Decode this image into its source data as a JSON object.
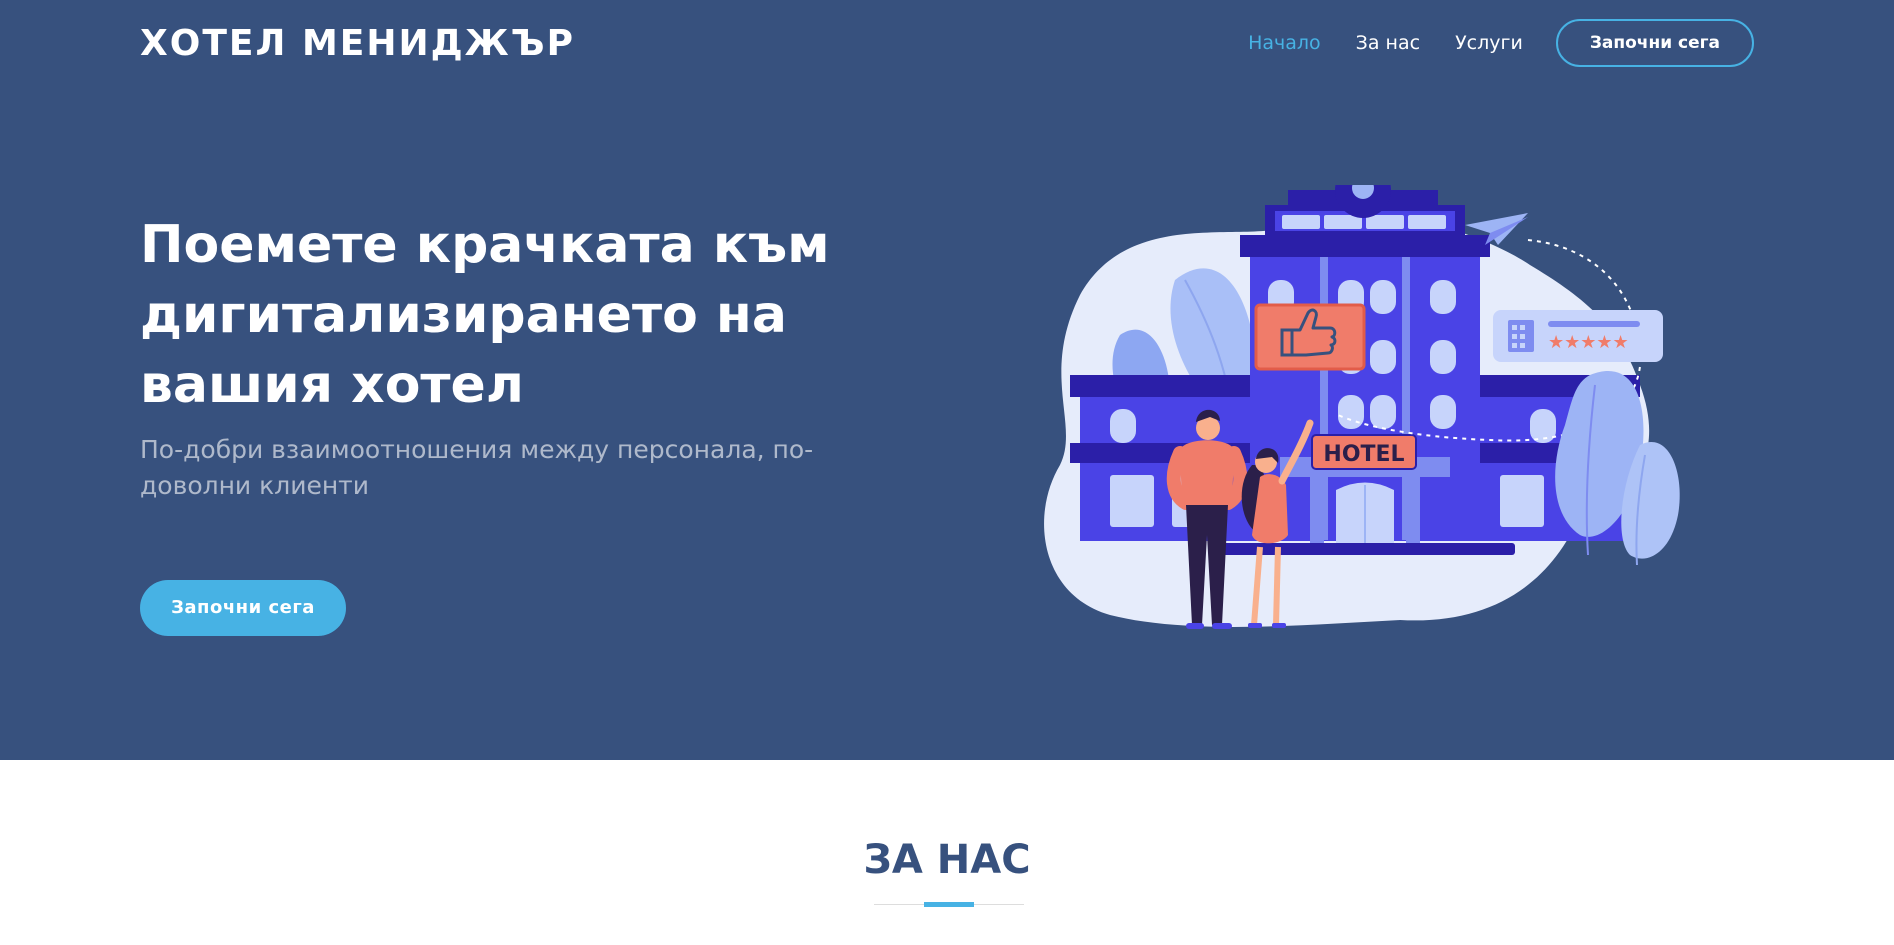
{
  "header": {
    "logo": "ХОТЕЛ МЕНИДЖЪР",
    "nav": [
      {
        "label": "Начало",
        "active": true
      },
      {
        "label": "За нас",
        "active": false
      },
      {
        "label": "Услуги",
        "active": false
      }
    ],
    "cta_label": "Започни сега"
  },
  "hero": {
    "title_lines": [
      "Поемете крачката към",
      "дигитализирането на",
      "вашия хотел"
    ],
    "subtitle": "По-добри взаимоотношения между персонала, по-доволни клиенти",
    "button_label": "Започни сега",
    "illustration": {
      "sign_text": "HOTEL",
      "rating_stars": 5,
      "icons": [
        "thumbs-up-icon",
        "paper-plane-icon",
        "building-icon",
        "star-icon"
      ]
    }
  },
  "about": {
    "title": "ЗА НАС"
  },
  "colors": {
    "hero_bg": "#37517e",
    "accent": "#47b2e4",
    "building": "#4a43e6",
    "building_dark": "#2b1fa8",
    "coral": "#f07c6a",
    "light_blue": "#9db4f5"
  }
}
